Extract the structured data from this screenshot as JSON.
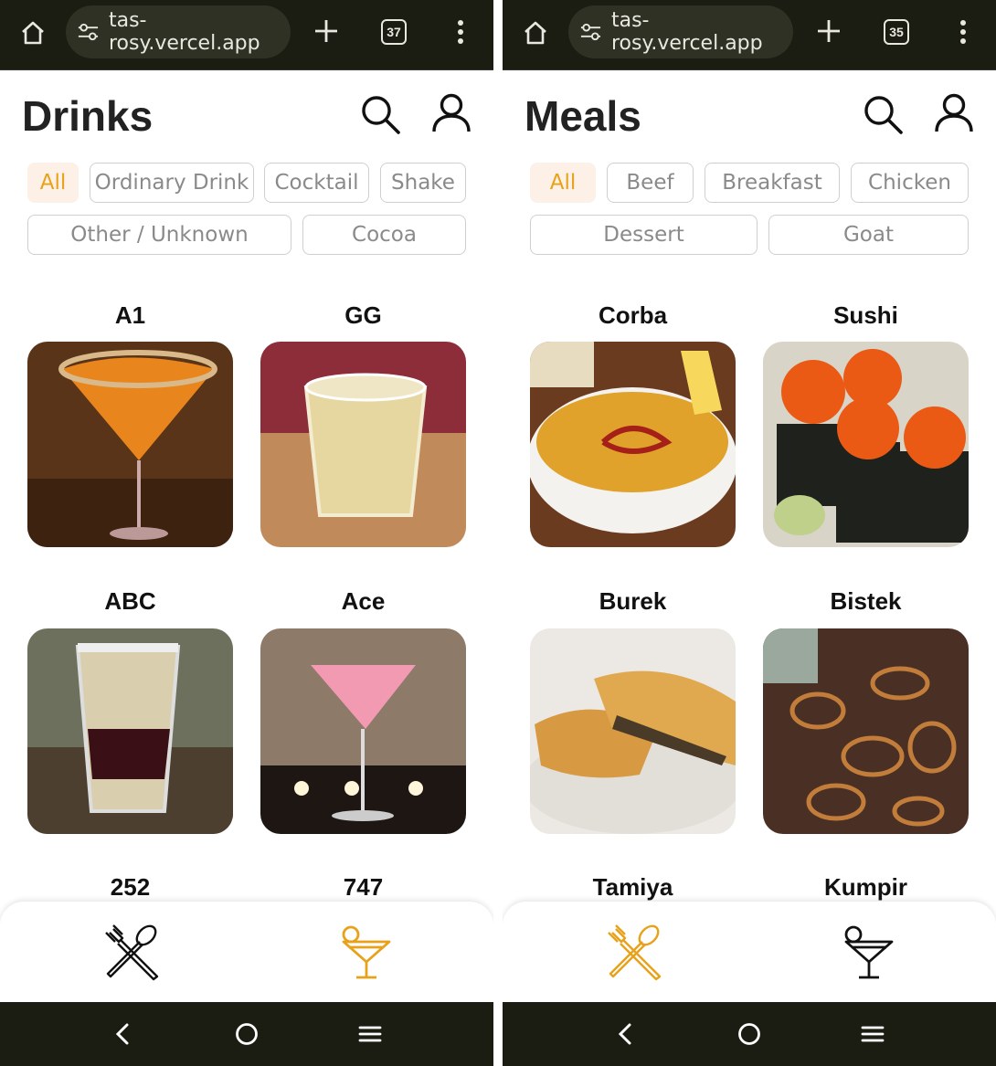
{
  "colors": {
    "accent": "#e8a21a",
    "chip_active_bg": "#fdf0e6",
    "browser_bar": "#1b1c12"
  },
  "left": {
    "browser": {
      "url": "tas-rosy.vercel.app",
      "tab_count": "37"
    },
    "title": "Drinks",
    "chips": [
      "All",
      "Ordinary Drink",
      "Cocktail",
      "Shake",
      "Other / Unknown",
      "Cocoa"
    ],
    "cards": [
      "A1",
      "GG",
      "ABC",
      "Ace",
      "252",
      "747"
    ],
    "active_nav": "drinks"
  },
  "right": {
    "browser": {
      "url": "tas-rosy.vercel.app",
      "tab_count": "35"
    },
    "title": "Meals",
    "chips": [
      "All",
      "Beef",
      "Breakfast",
      "Chicken",
      "Dessert",
      "Goat"
    ],
    "cards": [
      "Corba",
      "Sushi",
      "Burek",
      "Bistek",
      "Tamiya",
      "Kumpir"
    ],
    "active_nav": "meals"
  },
  "icons": {
    "home": "home-icon",
    "tune": "tune-icon",
    "plus": "plus-icon",
    "tabs": "tab-switcher-icon",
    "menu": "more-vert-icon",
    "search": "search-icon",
    "user": "user-icon",
    "meals": "fork-spoon-icon",
    "drinks": "cocktail-glass-icon",
    "back": "back-icon",
    "home_sys": "home-circle-icon",
    "recents": "menu-lines-icon"
  }
}
